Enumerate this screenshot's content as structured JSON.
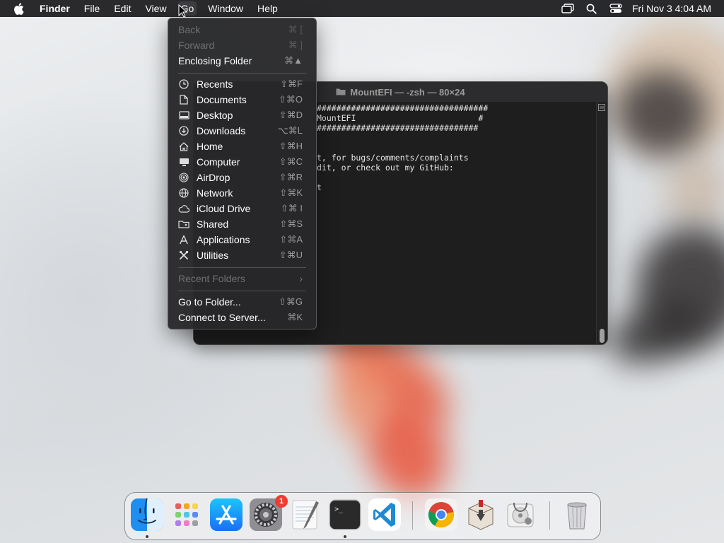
{
  "menubar": {
    "app_name": "Finder",
    "menus": [
      "File",
      "Edit",
      "View",
      "Go",
      "Window",
      "Help"
    ],
    "active_menu": "Go",
    "clock": "Fri Nov 3  4:04 AM",
    "icons": [
      "apple-logo-icon",
      "screen-mirroring-icon",
      "spotlight-search-icon",
      "control-center-icon"
    ]
  },
  "go_menu": {
    "items": [
      {
        "label": "Back",
        "shortcut": "⌘ [",
        "enabled": false
      },
      {
        "label": "Forward",
        "shortcut": "⌘ ]",
        "enabled": false
      },
      {
        "label": "Enclosing Folder",
        "shortcut": "⌘▲",
        "enabled": true
      },
      {
        "label": "Recents",
        "shortcut": "⇧⌘F",
        "icon": "clock-icon"
      },
      {
        "label": "Documents",
        "shortcut": "⇧⌘O",
        "icon": "document-icon"
      },
      {
        "label": "Desktop",
        "shortcut": "⇧⌘D",
        "icon": "desktop-icon"
      },
      {
        "label": "Downloads",
        "shortcut": "⌥⌘L",
        "icon": "download-icon"
      },
      {
        "label": "Home",
        "shortcut": "⇧⌘H",
        "icon": "home-icon"
      },
      {
        "label": "Computer",
        "shortcut": "⇧⌘C",
        "icon": "computer-icon"
      },
      {
        "label": "AirDrop",
        "shortcut": "⇧⌘R",
        "icon": "airdrop-icon"
      },
      {
        "label": "Network",
        "shortcut": "⇧⌘K",
        "icon": "network-globe-icon"
      },
      {
        "label": "iCloud Drive",
        "shortcut": "⇧⌘ I",
        "icon": "cloud-icon"
      },
      {
        "label": "Shared",
        "shortcut": "⇧⌘S",
        "icon": "shared-folder-icon"
      },
      {
        "label": "Applications",
        "shortcut": "⇧⌘A",
        "icon": "applications-icon"
      },
      {
        "label": "Utilities",
        "shortcut": "⇧⌘U",
        "icon": "utilities-tools-icon"
      },
      {
        "label": "Recent Folders",
        "enabled": false,
        "submenu": true
      },
      {
        "label": "Go to Folder...",
        "shortcut": "⇧⌘G"
      },
      {
        "label": "Connect to Server...",
        "shortcut": "⌘K"
      }
    ]
  },
  "terminal": {
    "title": "MountEFI — -zsh — 80×24",
    "lines": [
      "###################################",
      "MountEFI                         #",
      "#################################",
      "",
      "t, for bugs/comments/complaints",
      "dit, or check out my GitHub:",
      "",
      "t"
    ]
  },
  "dock": {
    "apps": [
      {
        "name": "Finder",
        "running": true
      },
      {
        "name": "Launchpad",
        "running": false
      },
      {
        "name": "App Store",
        "running": false
      },
      {
        "name": "System Settings",
        "running": false,
        "badge": "1"
      },
      {
        "name": "TextEdit",
        "running": false
      },
      {
        "name": "Terminal",
        "running": true
      },
      {
        "name": "Visual Studio Code",
        "running": false
      },
      {
        "name": "Google Chrome",
        "running": false
      },
      {
        "name": "Installer",
        "running": false
      },
      {
        "name": "Disk Utility",
        "running": false
      },
      {
        "name": "Trash",
        "running": false
      }
    ]
  }
}
